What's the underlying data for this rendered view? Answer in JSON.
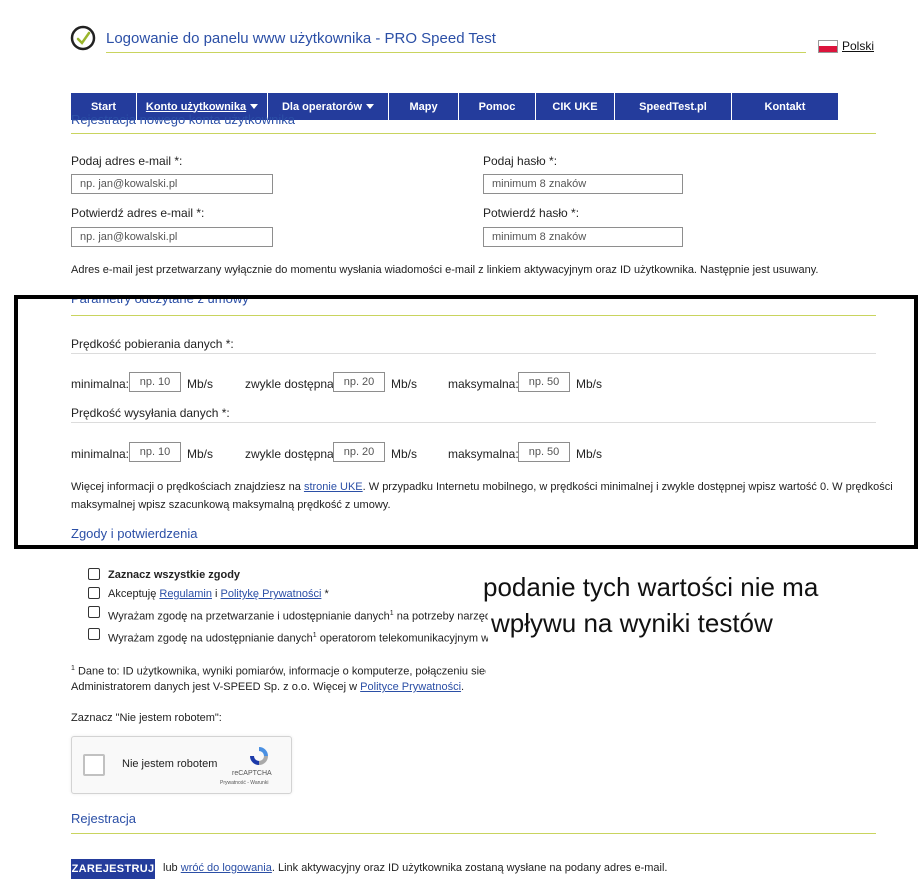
{
  "header": {
    "title": "Logowanie do panelu www użytkownika - PRO Speed Test",
    "language": "Polski"
  },
  "nav": {
    "items": [
      {
        "label": "Start"
      },
      {
        "label": "Konto użytkownika"
      },
      {
        "label": "Dla operatorów"
      },
      {
        "label": "Mapy"
      },
      {
        "label": "Pomoc"
      },
      {
        "label": "CIK UKE"
      },
      {
        "label": "SpeedTest.pl"
      },
      {
        "label": "Kontakt"
      }
    ]
  },
  "registration": {
    "title": "Rejestracja nowego konta użytkownika",
    "email_label": "Podaj adres e-mail *:",
    "email_placeholder": "np. jan@kowalski.pl",
    "email_confirm_label": "Potwierdź adres e-mail *:",
    "email_confirm_placeholder": "np. jan@kowalski.pl",
    "password_label": "Podaj hasło *:",
    "password_placeholder": "minimum 8 znaków",
    "password_confirm_label": "Potwierdź hasło *:",
    "password_confirm_placeholder": "minimum 8 znaków",
    "email_note": "Adres e-mail jest przetwarzany wyłącznie do momentu wysłania wiadomości e-mail z linkiem aktywacyjnym oraz ID użytkownika. Następnie jest usuwany."
  },
  "contract": {
    "title": "Parametry odczytane z umowy",
    "download_label": "Prędkość pobierania danych *:",
    "upload_label": "Prędkość wysyłania danych *:",
    "min_label": "minimalna:",
    "typical_label": "zwykle dostępna:",
    "max_label": "maksymalna:",
    "unit": "Mb/s",
    "min_placeholder": "np. 10",
    "typical_placeholder": "np. 20",
    "max_placeholder": "np. 50",
    "info_prefix": "Więcej informacji o prędkościach znajdziesz na ",
    "info_link": "stronie UKE",
    "info_suffix": ". W przypadku Internetu mobilnego, w prędkości minimalnej i zwykle dostępnej wpisz wartość 0. W prędkości",
    "info_line2": "maksymalnej wpisz szacunkową maksymalną prędkość z umowy."
  },
  "consents": {
    "title": "Zgody i potwierdzenia",
    "select_all": "Zaznacz wszystkie zgody",
    "accept_prefix": "Akceptuję ",
    "regulamin": "Regulamin",
    "and": " i ",
    "privacy_policy": "Politykę Prywatności",
    "accept_suffix": " *",
    "consent1_prefix": "Wyrażam zgodę na przetwarzanie i udostępnianie danych",
    "consent1_suffix": " na potrzeby narzędzia",
    "consent2_prefix": "Wyrażam zgodę na udostępnianie danych",
    "consent2_suffix": " operatorom telekomunikacyjnym w cel",
    "superscript": "1",
    "footnote_mark": "1",
    "footnote_line1": " Dane to: ID użytkownika, wyniki pomiarów, informacje o komputerze, połączeniu sieciow",
    "footnote_line2_prefix": "Administratorem danych jest V-SPEED Sp. z o.o. Więcej w ",
    "footnote_link": "Polityce Prywatności",
    "footnote_line2_suffix": "."
  },
  "captcha": {
    "prompt": "Zaznacz \"Nie jestem robotem\":",
    "label": "Nie jestem robotem",
    "brand": "reCAPTCHA",
    "terms": "Prywatność - Warunki"
  },
  "submit": {
    "title": "Rejestracja",
    "button": "ZAREJESTRUJ",
    "or": "lub ",
    "back_link": "wróć do logowania",
    "note": ". Link aktywacyjny oraz ID użytkownika zostaną wysłane na podany adres e-mail."
  },
  "annotation": {
    "line1": "podanie tych wartości nie ma",
    "line2": "wpływu na wyniki testów"
  },
  "colors": {
    "nav_bg": "#243c9c",
    "link": "#2b4fa6",
    "rule": "#c9d45e"
  }
}
